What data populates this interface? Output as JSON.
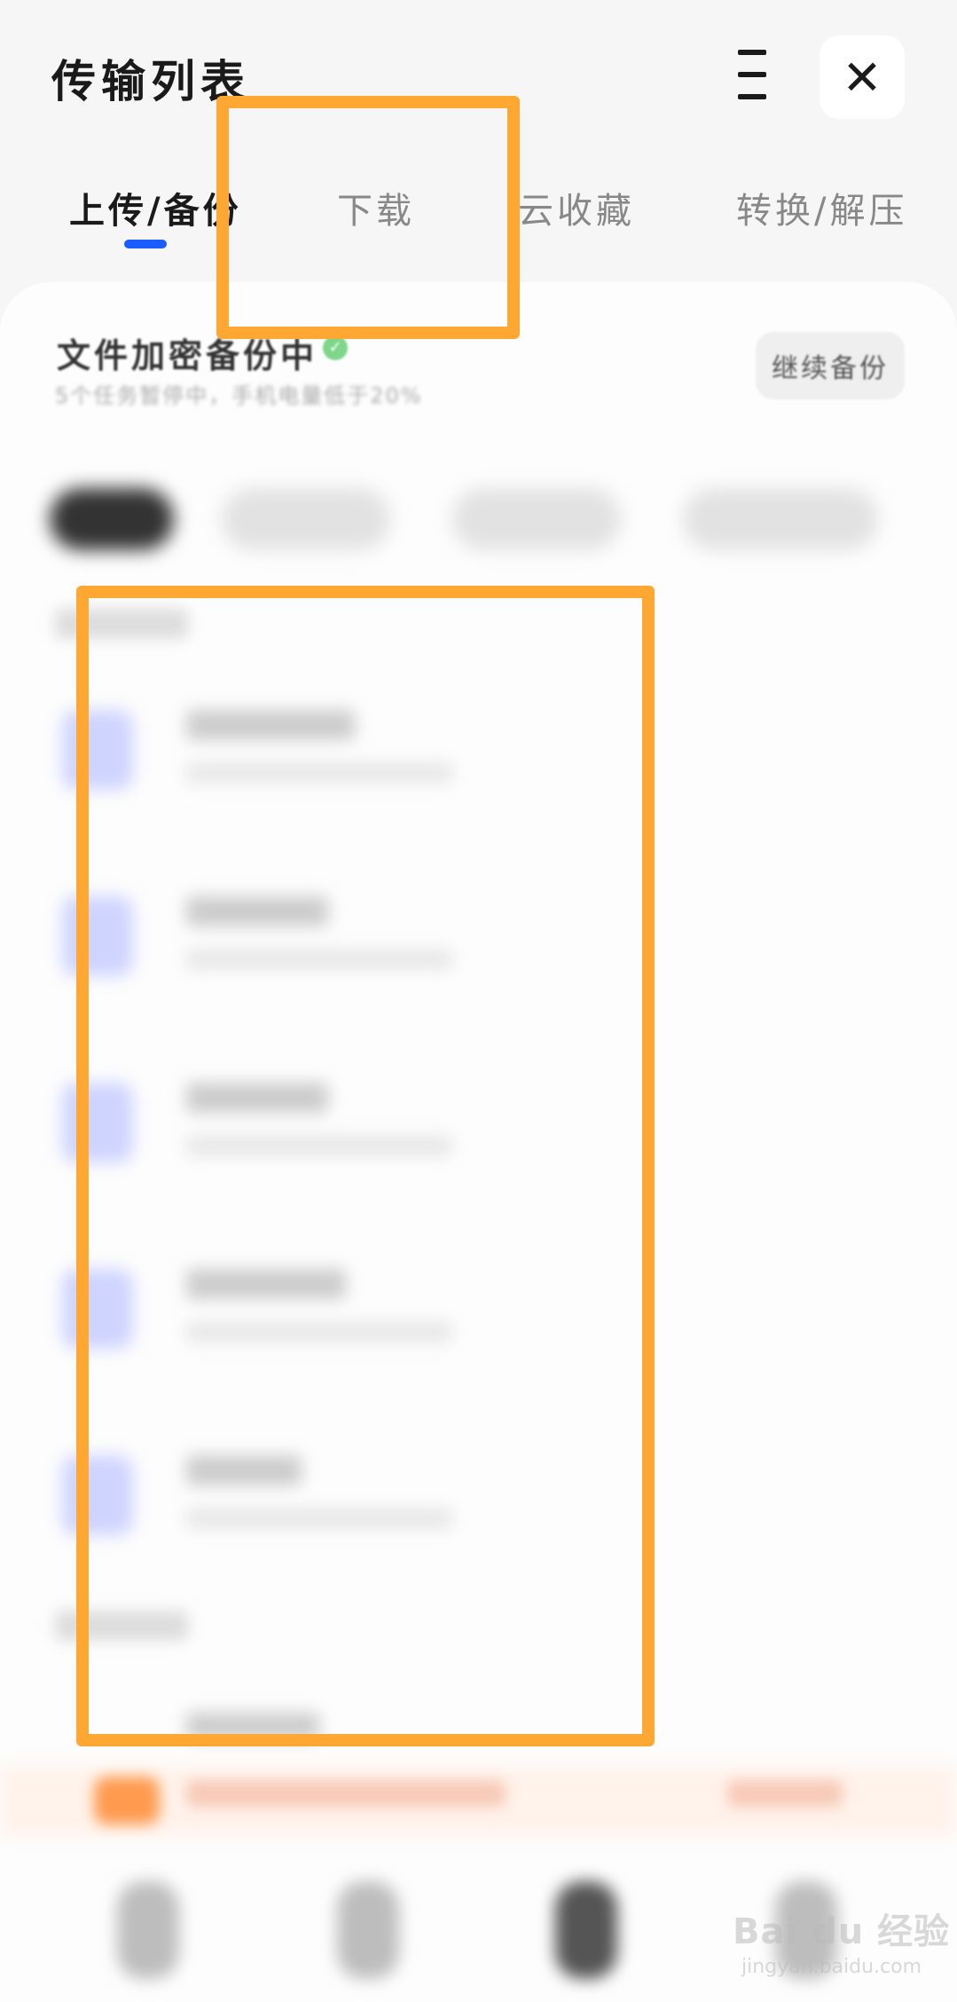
{
  "header": {
    "title": "传输列表",
    "close_label": "✕"
  },
  "tabs": [
    {
      "label": "上传/备份"
    },
    {
      "label": "下载"
    },
    {
      "label": "云收藏"
    },
    {
      "label": "转换/解压"
    }
  ],
  "colors": {
    "accent": "#1a5cff",
    "highlight": "#ffa733",
    "panel": "#fdfdfd",
    "page_bg": "#f6f6f6"
  },
  "backup": {
    "title": "文件加密备份中",
    "status_icon": "cloud-check-icon",
    "subtitle": "5个任务暂停中，手机电量低于20%",
    "continue_button": "继续备份"
  },
  "watermark": {
    "main": "Bai du 经验",
    "sub": "jingyan.baidu.com"
  }
}
